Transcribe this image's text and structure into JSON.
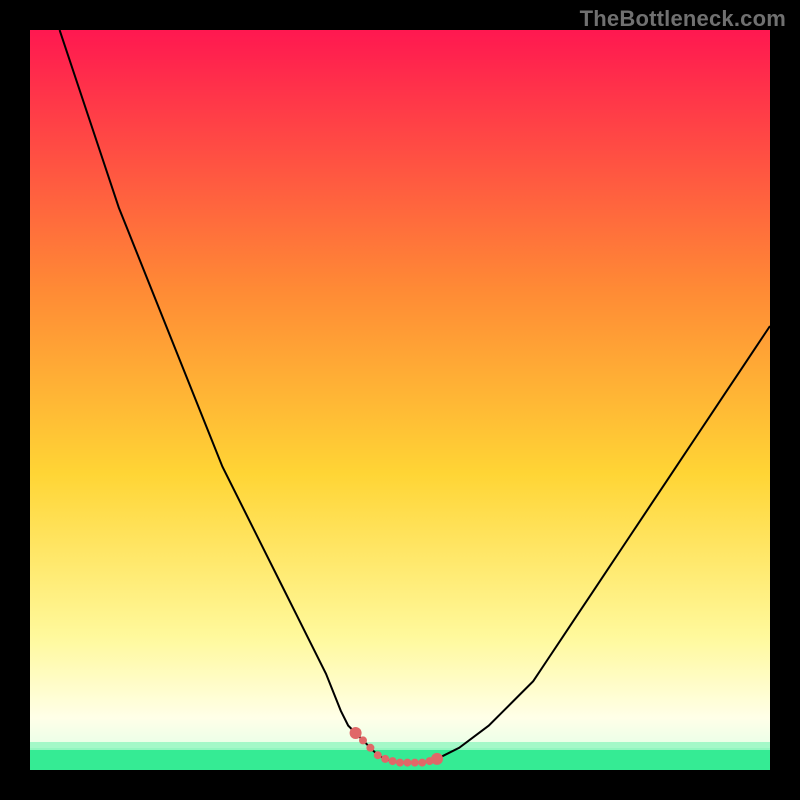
{
  "watermark": "TheBottleneck.com",
  "colors": {
    "frame": "#000000",
    "curve": "#000000",
    "dots": "#e06868",
    "bottom_band": "#35eb94",
    "grad_top": "#ff1850",
    "grad_mid1": "#ff6f3a",
    "grad_mid2": "#ffd535",
    "grad_mid3": "#fff99c",
    "grad_bottom": "#ffffe8"
  },
  "chart_data": {
    "type": "line",
    "title": "",
    "xlabel": "",
    "ylabel": "",
    "xlim": [
      0,
      100
    ],
    "ylim": [
      0,
      100
    ],
    "x": [
      4,
      6,
      8,
      10,
      12,
      14,
      16,
      18,
      20,
      22,
      24,
      26,
      28,
      30,
      32,
      34,
      36,
      38,
      40,
      42,
      43,
      44,
      45,
      46,
      47,
      48,
      49,
      50,
      51,
      52,
      53,
      54,
      55,
      56,
      58,
      60,
      62,
      64,
      66,
      68,
      70,
      72,
      74,
      76,
      78,
      80,
      82,
      84,
      86,
      88,
      90,
      92,
      94,
      96,
      98,
      100
    ],
    "values": [
      100,
      94,
      88,
      82,
      76,
      71,
      66,
      61,
      56,
      51,
      46,
      41,
      37,
      33,
      29,
      25,
      21,
      17,
      13,
      8,
      6,
      5,
      4,
      3,
      2,
      1.5,
      1.2,
      1,
      1,
      1,
      1,
      1.2,
      1.5,
      2,
      3,
      4.5,
      6,
      8,
      10,
      12,
      15,
      18,
      21,
      24,
      27,
      30,
      33,
      36,
      39,
      42,
      45,
      48,
      51,
      54,
      57,
      60
    ],
    "flat_region_x": [
      44,
      55
    ],
    "dot_points_x": [
      44,
      45,
      46,
      47,
      48,
      49,
      50,
      51,
      52,
      53,
      54,
      55
    ]
  }
}
